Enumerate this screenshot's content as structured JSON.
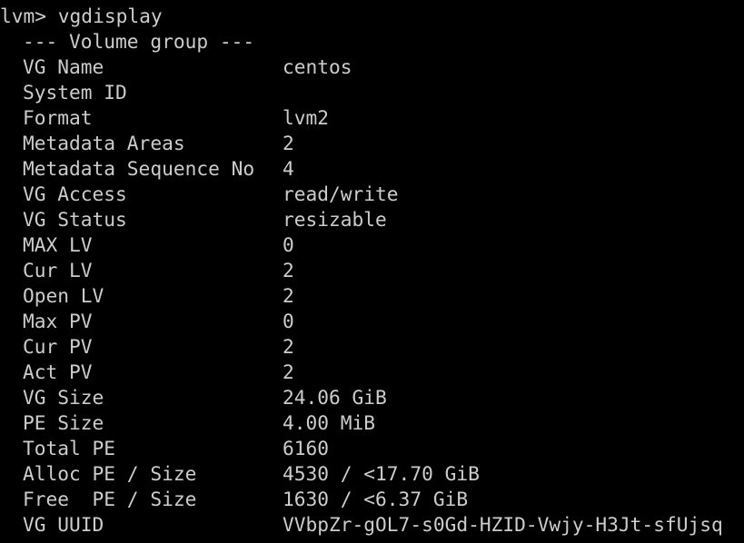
{
  "terminal": {
    "prompt": "lvm>",
    "command": "vgdisplay",
    "section_header": "--- Volume group ---",
    "rows": [
      {
        "label": "VG Name",
        "value": "centos"
      },
      {
        "label": "System ID",
        "value": ""
      },
      {
        "label": "Format",
        "value": "lvm2"
      },
      {
        "label": "Metadata Areas",
        "value": "2"
      },
      {
        "label": "Metadata Sequence No",
        "value": "4"
      },
      {
        "label": "VG Access",
        "value": "read/write"
      },
      {
        "label": "VG Status",
        "value": "resizable"
      },
      {
        "label": "MAX LV",
        "value": "0"
      },
      {
        "label": "Cur LV",
        "value": "2"
      },
      {
        "label": "Open LV",
        "value": "2"
      },
      {
        "label": "Max PV",
        "value": "0"
      },
      {
        "label": "Cur PV",
        "value": "2"
      },
      {
        "label": "Act PV",
        "value": "2"
      },
      {
        "label": "VG Size",
        "value": "24.06 GiB"
      },
      {
        "label": "PE Size",
        "value": "4.00 MiB"
      },
      {
        "label": "Total PE",
        "value": "6160"
      },
      {
        "label": "Alloc PE / Size",
        "value": "4530 / <17.70 GiB"
      },
      {
        "label": "Free  PE / Size",
        "value": "1630 / <6.37 GiB"
      },
      {
        "label": "VG UUID",
        "value": "VVbpZr-gOL7-s0Gd-HZID-Vwjy-H3Jt-sfUjsq"
      }
    ]
  },
  "colors": {
    "background": "#000000",
    "foreground": "#cccccc"
  }
}
